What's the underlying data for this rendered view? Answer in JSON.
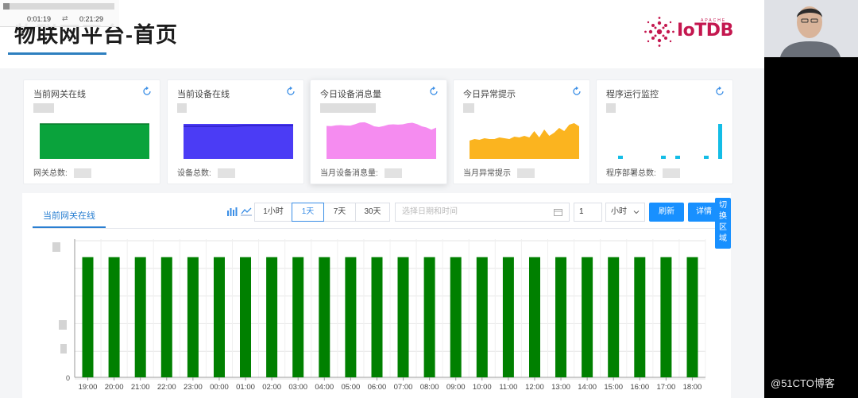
{
  "player": {
    "current_time": "0:01:19",
    "separator": "⇄",
    "duration": "0:21:29",
    "progress": 0.06
  },
  "header": {
    "title": "物联网平台-首页",
    "logo_text": "IoTDB",
    "logo_small": "APACHE"
  },
  "cards": [
    {
      "title": "当前网关在线",
      "footer": "网关总数:",
      "color": "#0aa33c",
      "kind": "flat"
    },
    {
      "title": "当前设备在线",
      "footer": "设备总数:",
      "color": "#4b3cf5",
      "kind": "flat"
    },
    {
      "title": "今日设备消息量",
      "footer": "当月设备消息量:",
      "color": "#f58cf0",
      "kind": "wave"
    },
    {
      "title": "今日异常提示",
      "footer": "当月异常提示",
      "color": "#fbb41f",
      "kind": "area"
    },
    {
      "title": "程序运行监控",
      "footer": "程序部署总数:",
      "color": "#14bde6",
      "kind": "bars"
    }
  ],
  "panel": {
    "tab": "当前网关在线",
    "ranges": [
      "1小时",
      "1天",
      "7天",
      "30天"
    ],
    "active_range": "1天",
    "date_placeholder": "选择日期和时间",
    "step_value": "1",
    "unit": "小时",
    "refresh": "刷新",
    "detail": "详情",
    "switch_area": [
      "切",
      "换",
      "区",
      "域"
    ]
  },
  "colors": {
    "accent": "#1890ff",
    "bar": "#008000"
  },
  "chart_data": {
    "type": "bar",
    "categories": [
      "19:00",
      "20:00",
      "21:00",
      "22:00",
      "23:00",
      "00:00",
      "01:00",
      "02:00",
      "03:00",
      "04:00",
      "05:00",
      "06:00",
      "07:00",
      "08:00",
      "09:00",
      "10:00",
      "11:00",
      "12:00",
      "13:00",
      "14:00",
      "15:00",
      "16:00",
      "17:00",
      "18:00"
    ],
    "values": [
      1,
      1,
      1,
      1,
      1,
      1,
      1,
      1,
      1,
      1,
      1,
      1,
      1,
      1,
      1,
      1,
      1,
      1,
      1,
      1,
      1,
      1,
      1,
      1
    ],
    "ylim": [
      0,
      1.15
    ],
    "grid": true,
    "ytick_labels": [
      "0"
    ]
  }
}
